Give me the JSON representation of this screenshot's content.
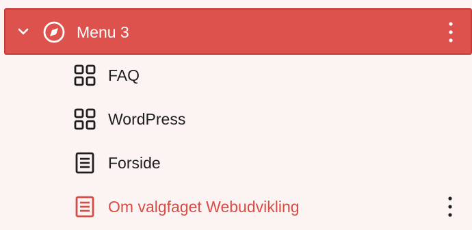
{
  "menu": {
    "title": "Menu 3",
    "expanded": true,
    "icon": "compass-icon",
    "colors": {
      "selected_background": "#dd524c",
      "panel_background": "#fbf4f3",
      "text": "#1e1e1e",
      "active_text": "#d94c46"
    }
  },
  "items": [
    {
      "label": "FAQ",
      "icon": "grid-icon"
    },
    {
      "label": "WordPress",
      "icon": "grid-icon"
    },
    {
      "label": "Forside",
      "icon": "page-icon"
    },
    {
      "label": "Om valgfaget Webudvikling",
      "icon": "page-icon",
      "active": true
    }
  ]
}
